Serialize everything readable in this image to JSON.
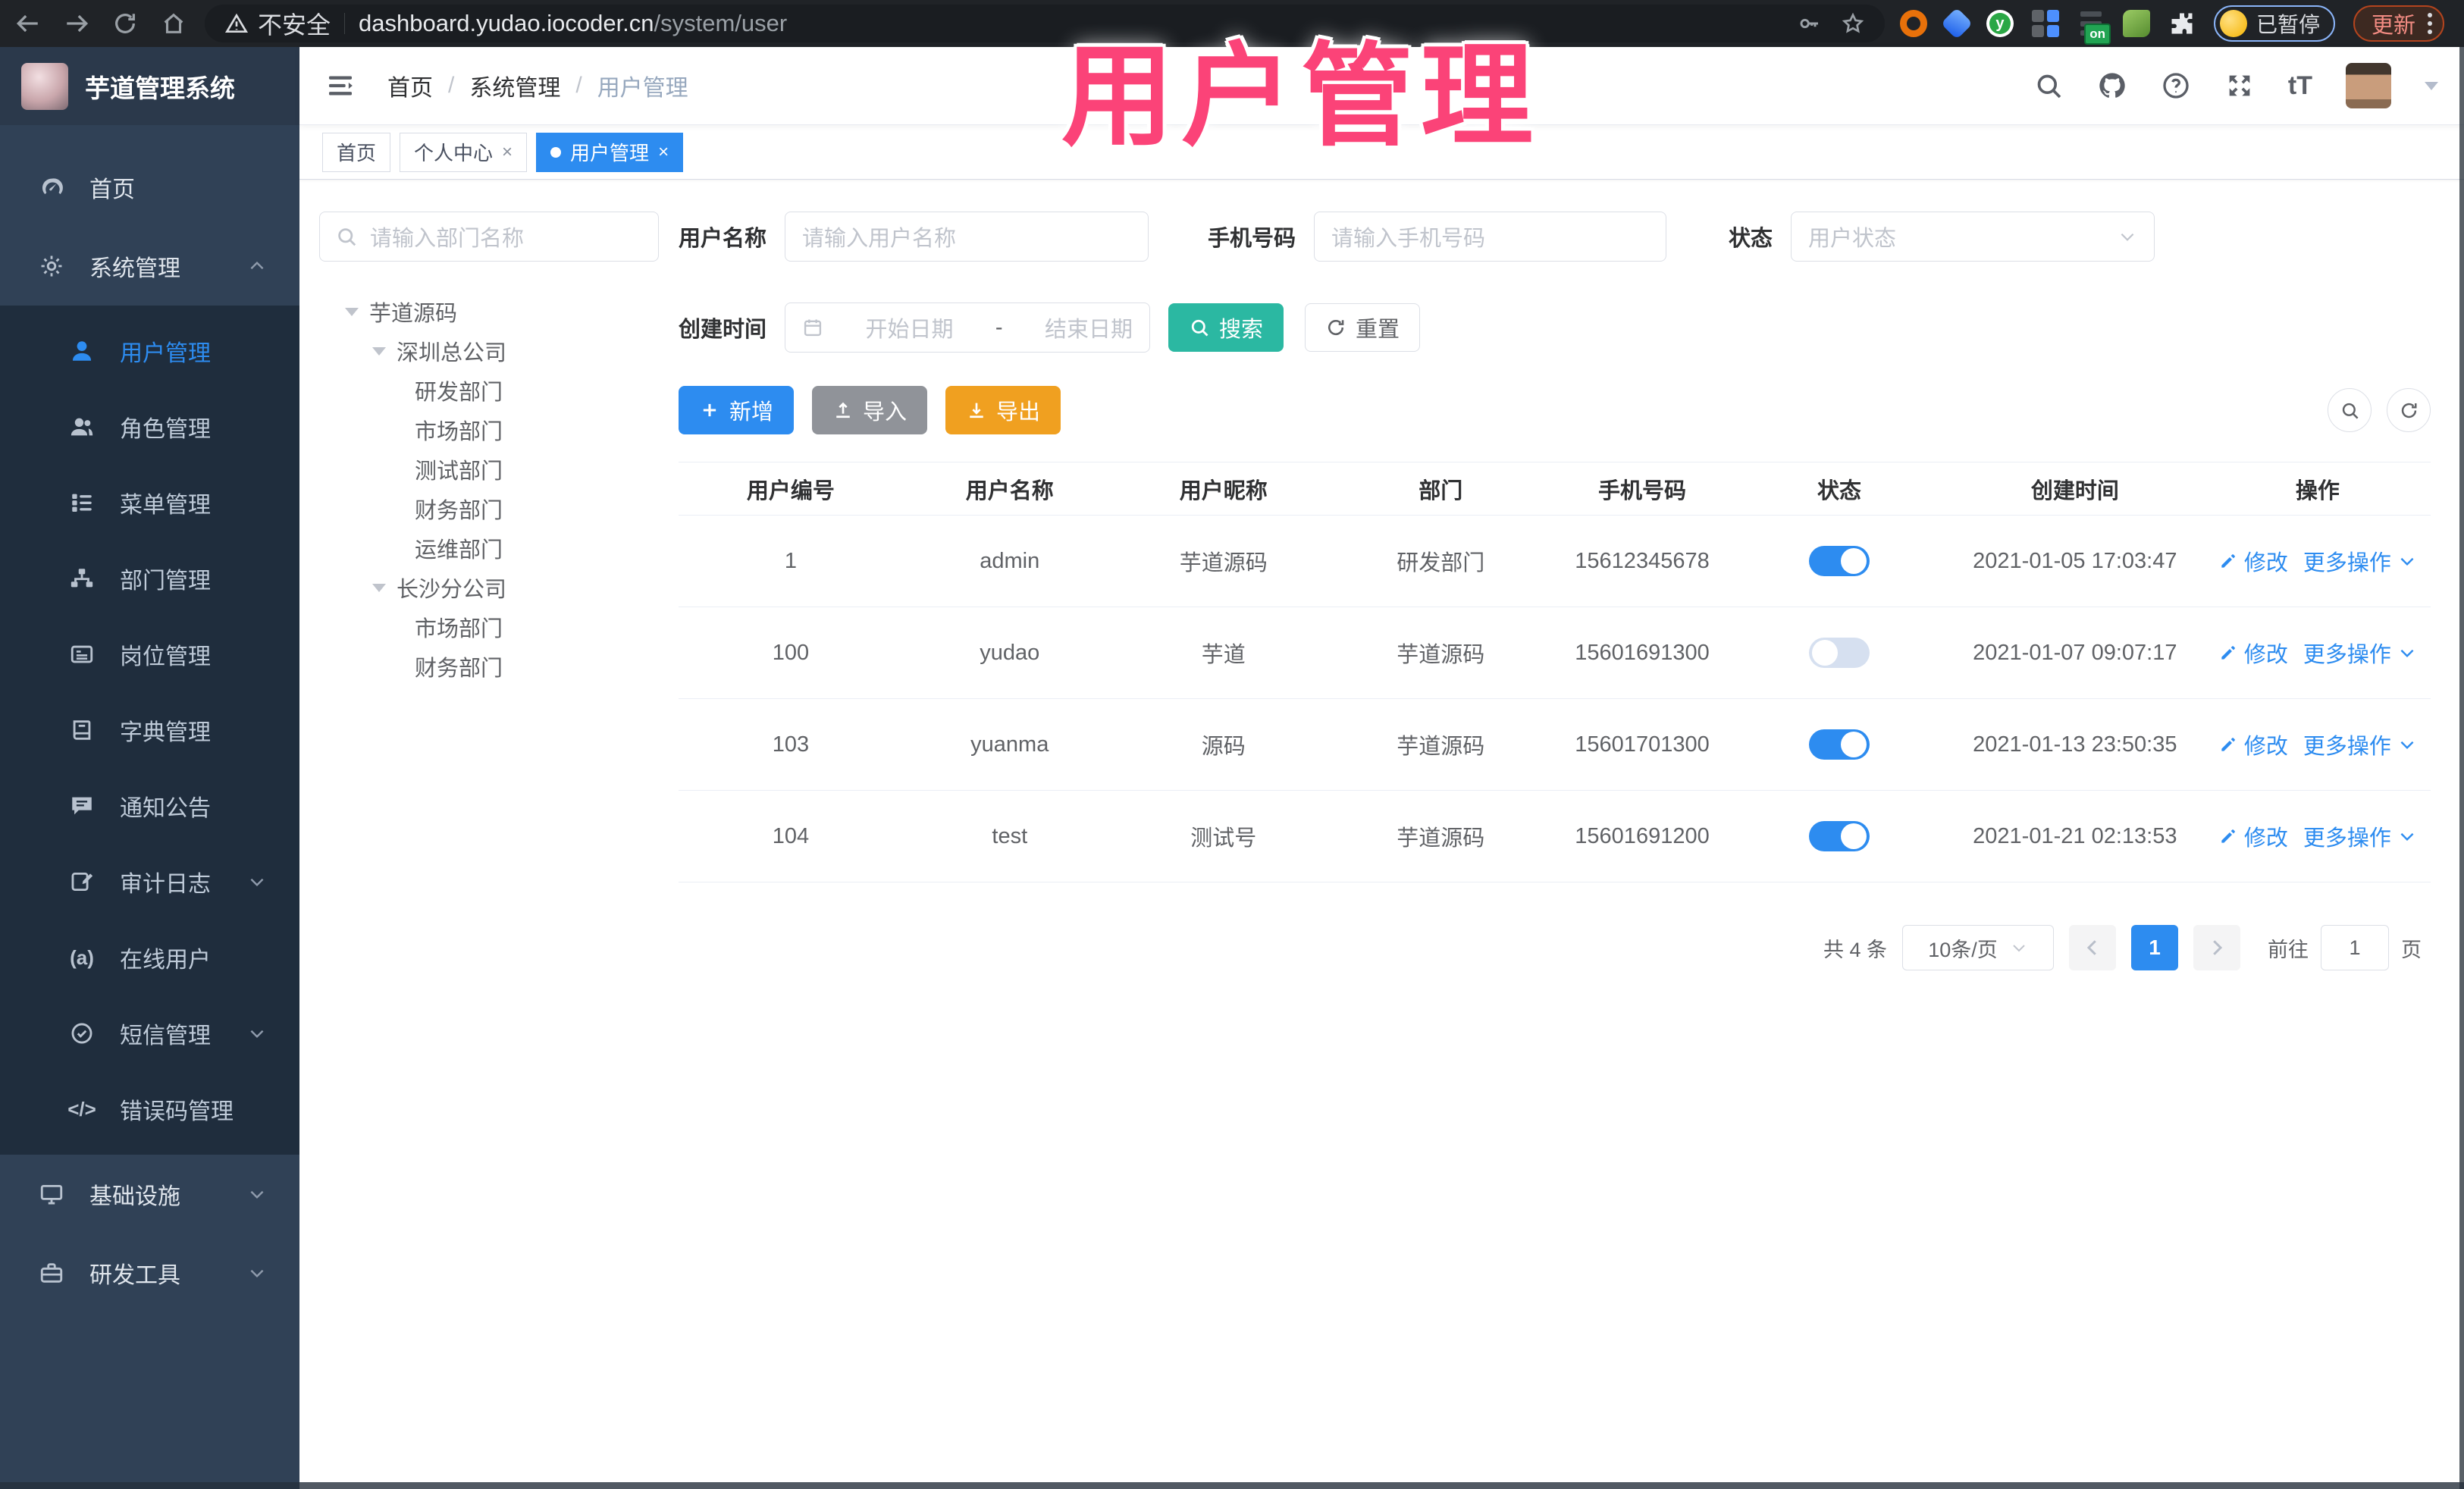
{
  "browser": {
    "security_label": "不安全",
    "url_domain": "dashboard.yudao.iocoder.cn",
    "url_path": "/system/user",
    "profile_badge": "已暂停",
    "update_label": "更新"
  },
  "overlay": {
    "text": "用户管理",
    "color": "#fb4378"
  },
  "app": {
    "title": "芋道管理系统"
  },
  "breadcrumb": {
    "items": [
      "首页",
      "系统管理",
      "用户管理"
    ]
  },
  "tabs": [
    {
      "name": "tab-home",
      "label": "首页",
      "active": false,
      "closable": false
    },
    {
      "name": "tab-profile",
      "label": "个人中心",
      "active": false,
      "closable": true
    },
    {
      "name": "tab-user-management",
      "label": "用户管理",
      "active": true,
      "closable": true
    }
  ],
  "sidebar": {
    "items": [
      {
        "name": "sidebar-item-home",
        "label": "首页",
        "icon": "home-icon",
        "level": "top"
      },
      {
        "name": "sidebar-item-system",
        "label": "系统管理",
        "icon": "gear-icon",
        "level": "top",
        "chevron": "up"
      },
      {
        "name": "sidebar-item-user-management",
        "label": "用户管理",
        "icon": "user-icon",
        "level": "sub",
        "active": true
      },
      {
        "name": "sidebar-item-role-management",
        "label": "角色管理",
        "icon": "users-icon",
        "level": "sub"
      },
      {
        "name": "sidebar-item-menu-management",
        "label": "菜单管理",
        "icon": "menu-list-icon",
        "level": "sub"
      },
      {
        "name": "sidebar-item-dept-management",
        "label": "部门管理",
        "icon": "org-tree-icon",
        "level": "sub"
      },
      {
        "name": "sidebar-item-post-management",
        "label": "岗位管理",
        "icon": "badge-icon",
        "level": "sub"
      },
      {
        "name": "sidebar-item-dict-management",
        "label": "字典管理",
        "icon": "dictionary-icon",
        "level": "sub"
      },
      {
        "name": "sidebar-item-notice",
        "label": "通知公告",
        "icon": "announcement-icon",
        "level": "sub"
      },
      {
        "name": "sidebar-item-audit-log",
        "label": "审计日志",
        "icon": "audit-log-icon",
        "level": "sub",
        "chevron": "down"
      },
      {
        "name": "sidebar-item-online-users",
        "label": "在线用户",
        "icon": "online-user-icon",
        "level": "sub"
      },
      {
        "name": "sidebar-item-sms",
        "label": "短信管理",
        "icon": "sms-icon",
        "level": "sub",
        "chevron": "down"
      },
      {
        "name": "sidebar-item-error-code",
        "label": "错误码管理",
        "icon": "error-code-icon",
        "level": "sub"
      },
      {
        "name": "sidebar-item-infrastructure",
        "label": "基础设施",
        "icon": "infrastructure-icon",
        "level": "top",
        "chevron": "down"
      },
      {
        "name": "sidebar-item-devtools",
        "label": "研发工具",
        "icon": "devtools-icon",
        "level": "top",
        "chevron": "down"
      }
    ]
  },
  "dept_tree": {
    "search_placeholder": "请输入部门名称",
    "nodes": [
      {
        "label": "芋道源码",
        "children": [
          {
            "label": "深圳总公司",
            "children": [
              {
                "label": "研发部门"
              },
              {
                "label": "市场部门"
              },
              {
                "label": "测试部门"
              },
              {
                "label": "财务部门"
              },
              {
                "label": "运维部门"
              }
            ]
          },
          {
            "label": "长沙分公司",
            "children": [
              {
                "label": "市场部门"
              },
              {
                "label": "财务部门"
              }
            ]
          }
        ]
      }
    ]
  },
  "filters": {
    "username_label": "用户名称",
    "username_placeholder": "请输入用户名称",
    "mobile_label": "手机号码",
    "mobile_placeholder": "请输入手机号码",
    "status_label": "状态",
    "status_placeholder": "用户状态",
    "created_label": "创建时间",
    "date_start_placeholder": "开始日期",
    "date_separator": "-",
    "date_end_placeholder": "结束日期",
    "search_label": "搜索",
    "reset_label": "重置"
  },
  "toolbar": {
    "add_label": "新增",
    "import_label": "导入",
    "export_label": "导出"
  },
  "table": {
    "columns": [
      "用户编号",
      "用户名称",
      "用户昵称",
      "部门",
      "手机号码",
      "状态",
      "创建时间",
      "操作"
    ],
    "edit_label": "修改",
    "more_label": "更多操作",
    "rows": [
      {
        "id": "1",
        "username": "admin",
        "nickname": "芋道源码",
        "dept": "研发部门",
        "mobile": "15612345678",
        "enabled": true,
        "created": "2021-01-05 17:03:47"
      },
      {
        "id": "100",
        "username": "yudao",
        "nickname": "芋道",
        "dept": "芋道源码",
        "mobile": "15601691300",
        "enabled": false,
        "created": "2021-01-07 09:07:17"
      },
      {
        "id": "103",
        "username": "yuanma",
        "nickname": "源码",
        "dept": "芋道源码",
        "mobile": "15601701300",
        "enabled": true,
        "created": "2021-01-13 23:50:35"
      },
      {
        "id": "104",
        "username": "test",
        "nickname": "测试号",
        "dept": "芋道源码",
        "mobile": "15601691200",
        "enabled": true,
        "created": "2021-01-21 02:13:53"
      }
    ]
  },
  "pagination": {
    "total_label": "共 4 条",
    "page_size": "10条/页",
    "current_page": "1",
    "goto_label": "前往",
    "goto_value": "1",
    "page_unit": "页"
  },
  "icon_glyphs": {
    "online-user-icon": "(a)",
    "error-code-icon": "</>",
    "font-size-icon": "tT"
  },
  "colors": {
    "primary": "#2d8cf0",
    "teal": "#2bb8a2",
    "warning": "#f0a020",
    "info": "#909399",
    "sidebar": "#304156",
    "submenu": "#1f2d3d"
  }
}
